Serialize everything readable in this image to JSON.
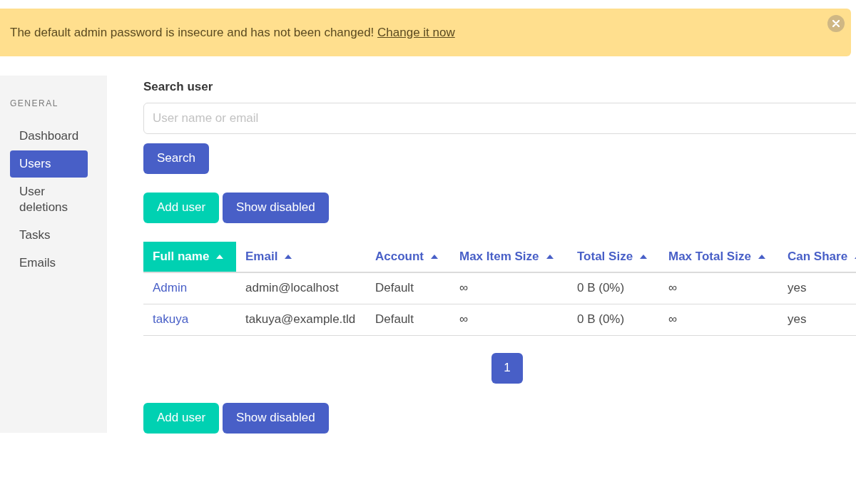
{
  "notification": {
    "message": "The default admin password is insecure and has not been changed!",
    "link": "Change it now"
  },
  "sidebar": {
    "heading": "GENERAL",
    "items": [
      {
        "label": "Dashboard",
        "selected": false
      },
      {
        "label": "Users",
        "selected": true
      },
      {
        "label": "User deletions",
        "selected": false
      },
      {
        "label": "Tasks",
        "selected": false
      },
      {
        "label": "Emails",
        "selected": false
      }
    ]
  },
  "search": {
    "label": "Search user",
    "placeholder": "User name or email",
    "button": "Search"
  },
  "actions": [
    "Add user",
    "Show disabled"
  ],
  "table": {
    "columns": [
      {
        "label": "Full name",
        "selected": true
      },
      {
        "label": "Email",
        "selected": false
      },
      {
        "label": "Account",
        "selected": false
      },
      {
        "label": "Max Item Size",
        "selected": false
      },
      {
        "label": "Total Size",
        "selected": false
      },
      {
        "label": "Max Total Size",
        "selected": false
      },
      {
        "label": "Can Share",
        "selected": false
      }
    ],
    "rows": [
      [
        "Admin",
        "admin@localhost",
        "Default",
        "∞",
        "0 B (0%)",
        "∞",
        "yes"
      ],
      [
        "takuya",
        "takuya@example.tld",
        "Default",
        "∞",
        "0 B (0%)",
        "∞",
        "yes"
      ]
    ]
  },
  "pagination": [
    {
      "label": "1",
      "selected": true
    }
  ],
  "bottom_actions": [
    "Add user",
    "Show disabled"
  ]
}
